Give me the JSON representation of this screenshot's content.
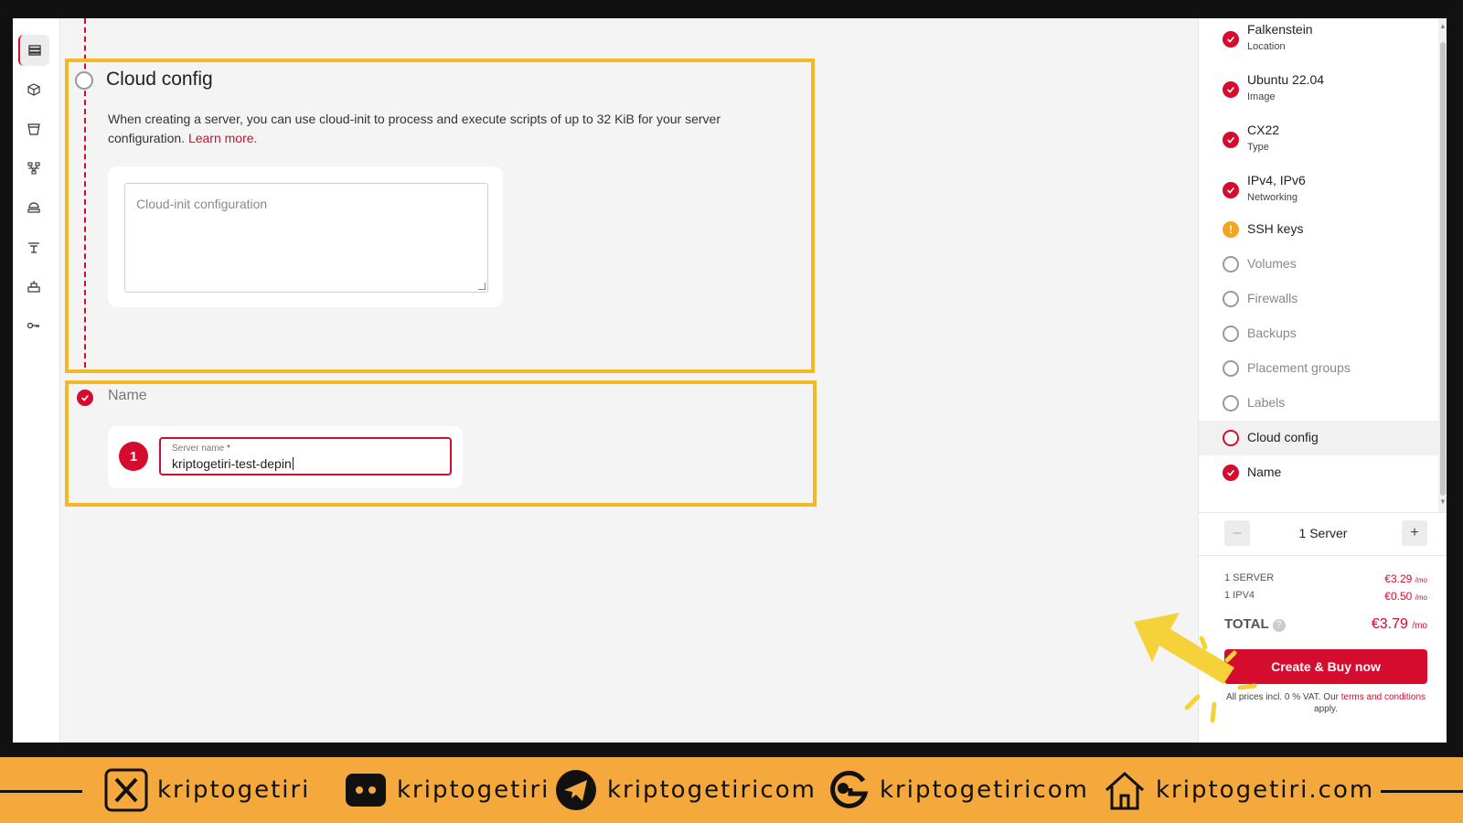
{
  "main": {
    "cloud_config": {
      "title": "Cloud config",
      "description": "When creating a server, you can use cloud-init to process and execute scripts of up to 32 KiB for your server configuration.",
      "learn_more": "Learn more.",
      "textarea_placeholder": "Cloud-init configuration"
    },
    "name_section": {
      "title": "Name",
      "step_number": "1",
      "field_label": "Server name",
      "required_mark": "*",
      "field_value": "kriptogetiri-test-depin"
    }
  },
  "sidebar": {
    "steps": [
      {
        "label": "Falkenstein",
        "sub": "Location",
        "state": "done"
      },
      {
        "label": "Ubuntu 22.04",
        "sub": "Image",
        "state": "done"
      },
      {
        "label": "CX22",
        "sub": "Type",
        "state": "done"
      },
      {
        "label": "IPv4, IPv6",
        "sub": "Networking",
        "state": "done"
      },
      {
        "label": "SSH keys",
        "sub": "",
        "state": "warning"
      },
      {
        "label": "Volumes",
        "sub": "",
        "state": "empty"
      },
      {
        "label": "Firewalls",
        "sub": "",
        "state": "empty"
      },
      {
        "label": "Backups",
        "sub": "",
        "state": "empty"
      },
      {
        "label": "Placement groups",
        "sub": "",
        "state": "empty"
      },
      {
        "label": "Labels",
        "sub": "",
        "state": "empty"
      },
      {
        "label": "Cloud config",
        "sub": "",
        "state": "current"
      },
      {
        "label": "Name",
        "sub": "",
        "state": "done"
      }
    ],
    "quantity": {
      "minus": "–",
      "label": "1 Server",
      "plus": "+"
    },
    "prices": [
      {
        "label": "1 SERVER",
        "value": "€3.29",
        "unit": "/mo"
      },
      {
        "label": "1 IPV4",
        "value": "€0.50",
        "unit": "/mo"
      }
    ],
    "total": {
      "label": "TOTAL",
      "help": "?",
      "value": "€3.79",
      "unit": "/mo"
    },
    "buy_button": "Create & Buy now",
    "vat_note": "All prices incl. 0 % VAT. Our",
    "vat_link": "terms and conditions",
    "vat_suffix": "apply."
  },
  "footer": {
    "x": "kriptogetiri",
    "discord": "kriptogetiri",
    "telegram": "kriptogetiricom",
    "g_logo": "kriptogetiricom",
    "home": "kriptogetiri.com"
  },
  "colors": {
    "accent": "#d50c2d",
    "highlight": "#f2b825",
    "warning": "#f2a51f",
    "footer_bg": "#f5a93c"
  }
}
